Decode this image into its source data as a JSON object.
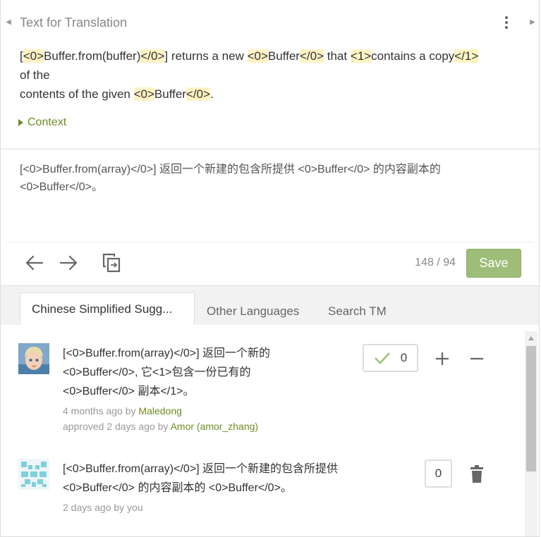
{
  "header": {
    "title": "Text for Translation"
  },
  "source": {
    "prefix": "[",
    "t0": "<0>",
    "w1": "Buffer.from(buffer)",
    "t1": "</0>",
    "m1": "] returns a new ",
    "t2": "<0>",
    "w2": "Buffer",
    "t3": "</0>",
    "m2": " that ",
    "t4": "<1>",
    "w3": "contains a copy",
    "t5": "</1>",
    "m3": " of the",
    "line2a": "contents of the given ",
    "t6": "<0>",
    "w4": "Buffer",
    "t7": "</0>",
    "end": "."
  },
  "context_label": "Context",
  "translation": {
    "line1": "[<0>Buffer.from(array)</0>] 返回一个新建的包含所提供 <0>Buffer</0> 的内容副本的",
    "line2": "<0>Buffer</0>。"
  },
  "toolbar": {
    "counter": "148 / 94",
    "save_label": "Save"
  },
  "tabs": [
    {
      "label": "Chinese Simplified Sugg..."
    },
    {
      "label": "Other Languages"
    },
    {
      "label": "Search TM"
    }
  ],
  "suggestions": [
    {
      "line1": "[<0>Buffer.from(array)</0>] 返回一个新的",
      "line2": "<0>Buffer</0>, 它<1>包含一份已有的",
      "line3": "<0>Buffer</0> 副本</1>。",
      "meta1_prefix": "4 months ago by ",
      "meta1_user": "Maledong",
      "meta2_prefix": "approved 2 days ago by ",
      "meta2_user": "Amor (amor_zhang)",
      "votes": "0"
    },
    {
      "line1": "[<0>Buffer.from(array)</0>] 返回一个新建的包含所提供",
      "line2": "<0>Buffer</0> 的内容副本的 <0>Buffer</0>。",
      "meta1": "2 days ago by you",
      "votes": "0"
    }
  ],
  "colors": {
    "accent_green": "#6b8e23",
    "save_button": "#9dbd79",
    "tag_highlight": "#fff3c4"
  },
  "icons": {
    "prev": "arrow-left-icon",
    "next": "arrow-right-icon",
    "copy": "copy-source-icon",
    "approve": "checkmark-icon",
    "upvote": "plus-icon",
    "downvote": "minus-icon",
    "delete": "trash-icon",
    "menu": "kebab-menu-icon"
  }
}
